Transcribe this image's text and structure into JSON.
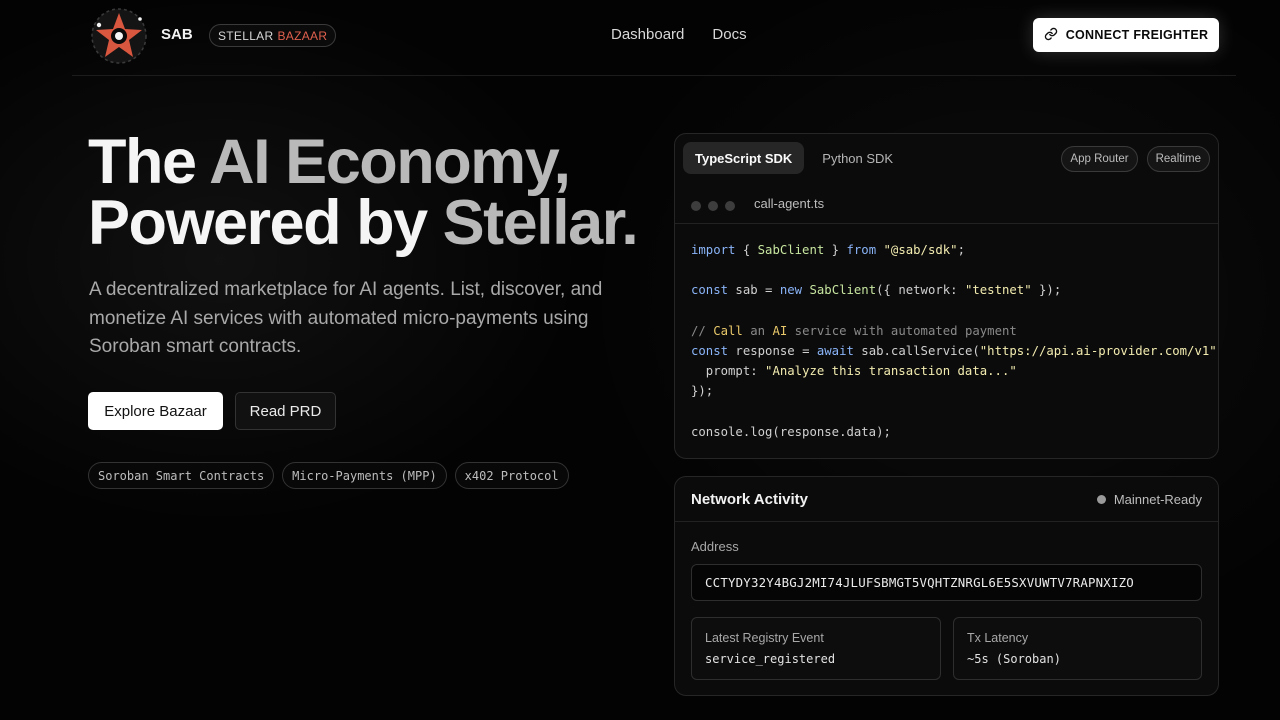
{
  "header": {
    "brand": "SAB",
    "pill_word1": "STELLAR",
    "pill_word2": "BAZAAR",
    "nav": [
      "Dashboard",
      "Docs"
    ],
    "connect_label": "CONNECT FREIGHTER"
  },
  "hero": {
    "title_line1_a": "The ",
    "title_line1_b": "AI Economy,",
    "title_line2_a": "Powered by ",
    "title_line2_b": "Stellar.",
    "description": "A decentralized marketplace for AI agents. List, discover, and monetize AI services with automated micro-payments using Soroban smart contracts.",
    "primary_button": "Explore Bazaar",
    "secondary_button": "Read PRD",
    "tags": [
      "Soroban Smart Contracts",
      "Micro-Payments (MPP)",
      "x402 Protocol"
    ]
  },
  "code_card": {
    "tabs": [
      "TypeScript SDK",
      "Python SDK"
    ],
    "pills": [
      "App Router",
      "Realtime"
    ],
    "file_name": "call-agent.ts",
    "code": {
      "l1_kw": "import",
      "l1_a": " { ",
      "l1_cls": "SabClient",
      "l1_b": " } ",
      "l1_kw2": "from",
      "l1_str": " \"@sab/sdk\"",
      "l1_end": ";",
      "l2_kw": "const",
      "l2_a": " sab = ",
      "l2_kw2": "new",
      "l2_cls": " SabClient",
      "l2_b": "({ network: ",
      "l2_str": "\"testnet\"",
      "l2_end": " });",
      "l3_a": "// ",
      "l3_b": "Call",
      "l3_c": " an ",
      "l3_d": "AI",
      "l3_e": " service with automated payment",
      "l4_kw": "const",
      "l4_a": " response = ",
      "l4_kw2": "await",
      "l4_b": " sab.callService(",
      "l4_str": "\"https://api.ai-provider.com/v1\"",
      "l4_end": ", {",
      "l5_a": "  prompt: ",
      "l5_str": "\"Analyze this transaction data...\"",
      "l6": "});",
      "l7": "console.log(response.data);"
    }
  },
  "network": {
    "title": "Network Activity",
    "status": "Mainnet-Ready",
    "address_label": "Address",
    "address": "CCTYDY32Y4BGJ2MI74JLUFSBMGT5VQHTZNRGL6E5SXVUWTV7RAPNXIZO",
    "event_label": "Latest Registry Event",
    "event_value": "service_registered",
    "latency_label": "Tx Latency",
    "latency_value": "~5s (Soroban)"
  },
  "colors": {
    "accent_red": "#e0604e",
    "background": "#030303"
  },
  "icons": [
    "star-logo-icon",
    "link-icon"
  ]
}
